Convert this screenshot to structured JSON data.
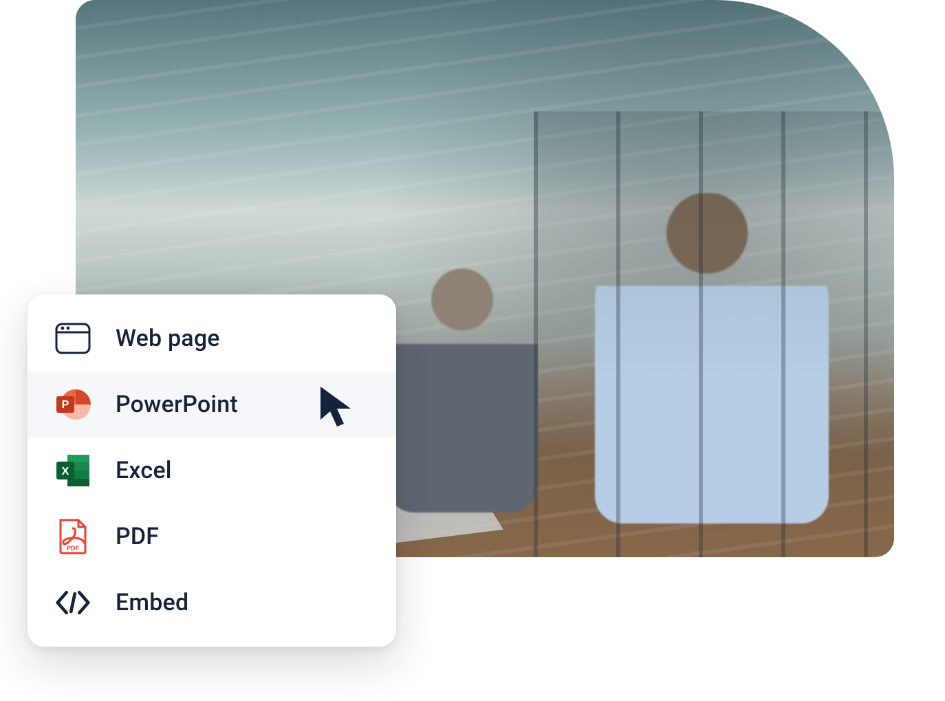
{
  "export_menu": {
    "items": [
      {
        "key": "webpage",
        "label": "Web page",
        "icon": "browser-icon",
        "selected": false
      },
      {
        "key": "powerpoint",
        "label": "PowerPoint",
        "icon": "powerpoint-icon",
        "selected": true
      },
      {
        "key": "excel",
        "label": "Excel",
        "icon": "excel-icon",
        "selected": false
      },
      {
        "key": "pdf",
        "label": "PDF",
        "icon": "pdf-icon",
        "selected": false
      },
      {
        "key": "embed",
        "label": "Embed",
        "icon": "code-icon",
        "selected": false
      }
    ]
  },
  "colors": {
    "text": "#15233a",
    "hover_bg": "#f5f7fa",
    "powerpoint": "#d7472a",
    "excel": "#107c41",
    "pdf": "#e8432e"
  }
}
